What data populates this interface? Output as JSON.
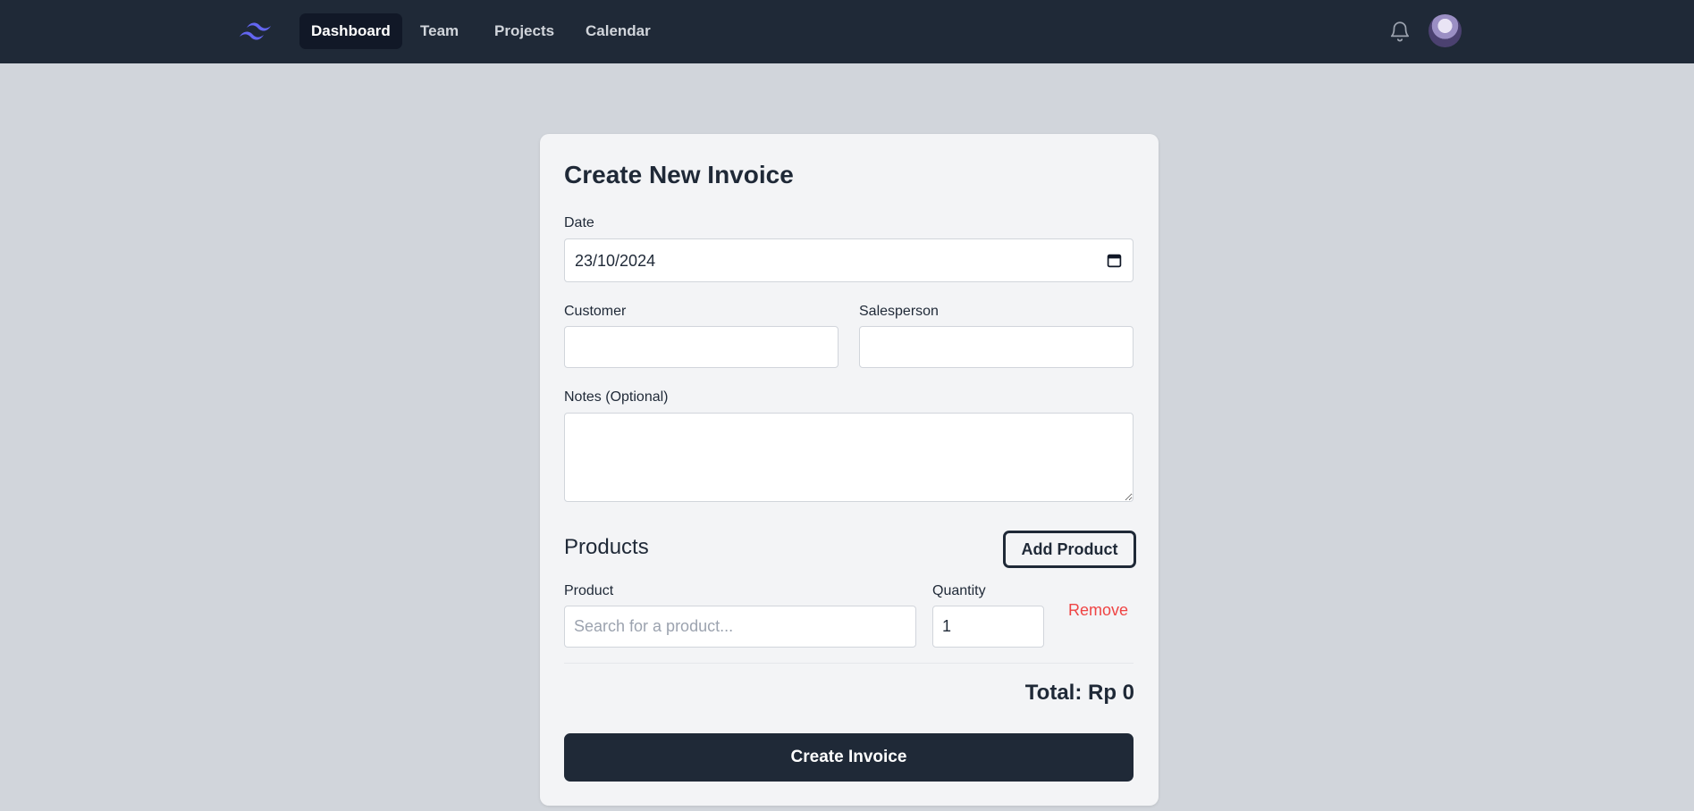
{
  "nav": {
    "items": [
      {
        "label": "Dashboard",
        "active": true
      },
      {
        "label": "Team",
        "active": false
      },
      {
        "label": "Projects",
        "active": false
      },
      {
        "label": "Calendar",
        "active": false
      }
    ],
    "logo_icon": "tailwind-logo-icon",
    "bell_icon": "bell-icon",
    "logo_color": "#6366f1"
  },
  "form": {
    "title": "Create New Invoice",
    "date": {
      "label": "Date",
      "value": "23/10/2024"
    },
    "customer": {
      "label": "Customer",
      "value": ""
    },
    "salesperson": {
      "label": "Salesperson",
      "value": ""
    },
    "notes": {
      "label": "Notes (Optional)",
      "value": ""
    },
    "products": {
      "title": "Products",
      "add_label": "Add Product",
      "product_label": "Product",
      "product_placeholder": "Search for a product...",
      "quantity_label": "Quantity",
      "quantity_value": "1",
      "remove_label": "Remove"
    },
    "total": "Total: Rp 0",
    "submit_label": "Create Invoice"
  },
  "colors": {
    "navbar": "#1f2937",
    "page_bg": "#d1d5db",
    "card_bg": "#f3f4f6",
    "danger": "#ef4444",
    "primary": "#1f2937"
  }
}
